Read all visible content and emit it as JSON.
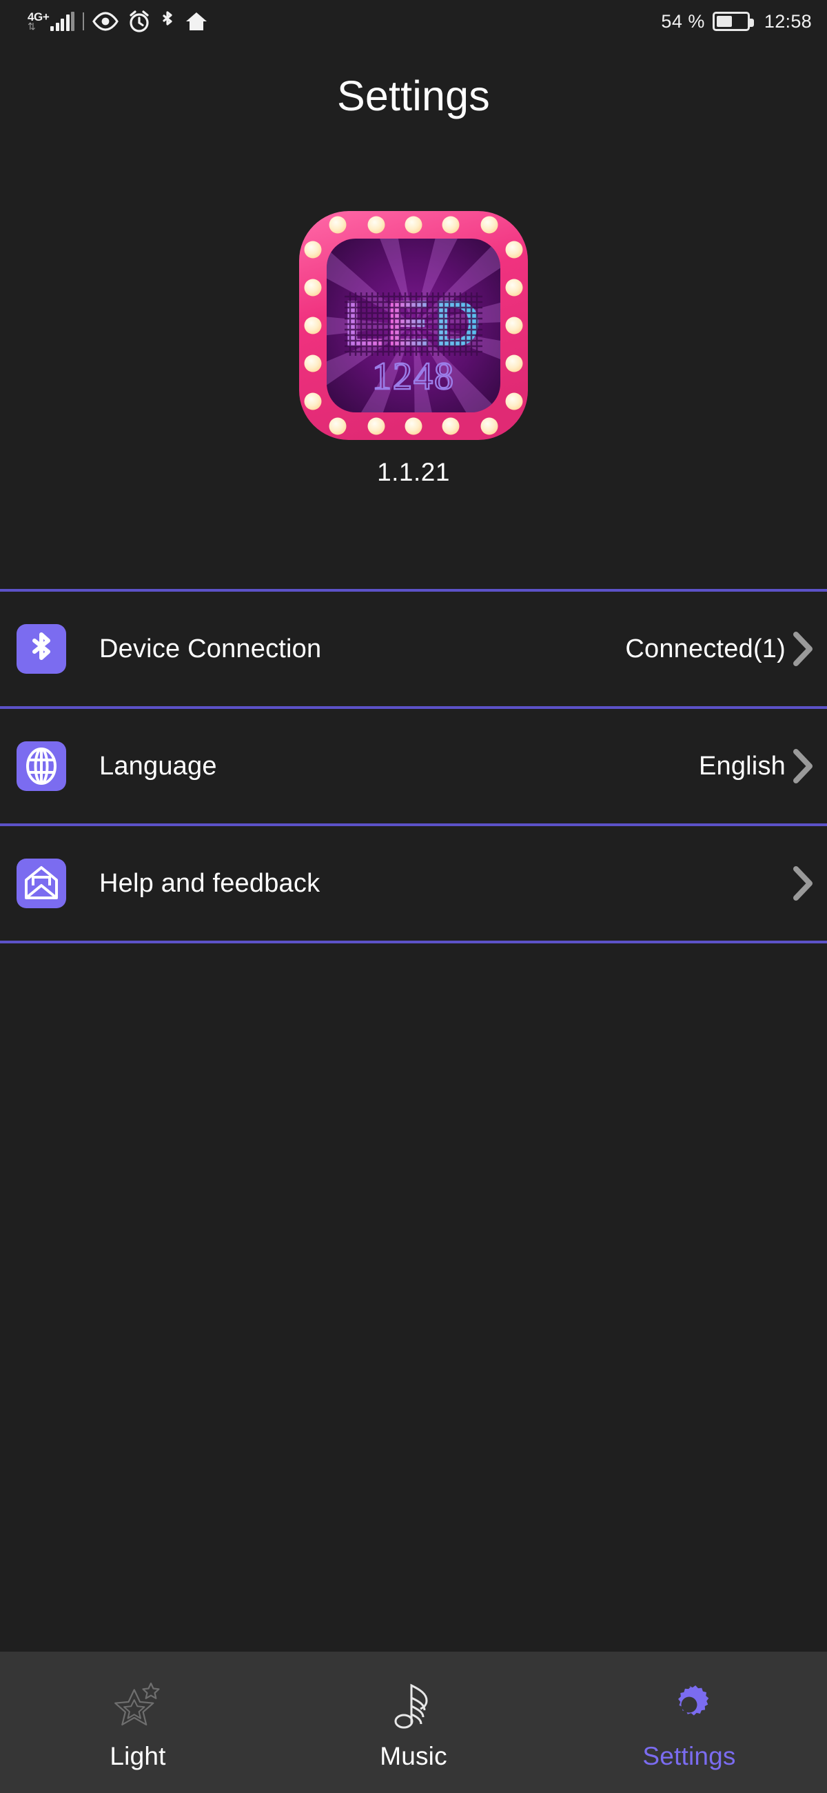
{
  "statusbar": {
    "network_generation": "4G+",
    "data_arrows": "⇅",
    "signal_icon": "signal-bars-icon",
    "eye_icon": "eye-icon",
    "alarm_icon": "alarm-clock-icon",
    "bluetooth_icon": "bluetooth-icon",
    "home_icon": "home-icon",
    "battery_percent": "54 %",
    "battery_icon": "battery-icon",
    "time": "12:58"
  },
  "header": {
    "title": "Settings"
  },
  "app_logo": {
    "icon_name": "led-1248-app-logo",
    "marquee_text": "LED",
    "sub_text": "1248",
    "version": "1.1.21",
    "frame_color": "#f0478f",
    "bulb_color": "#fff3dd",
    "screen_color": "#5d0f6b",
    "led_pink": "#f06fe0",
    "led_blue": "#56c8f5",
    "sub_text_color": "#9b7de8"
  },
  "settings_list": {
    "divider_color": "#5c52c8",
    "tile_color": "#7b6cf0",
    "chevron_color": "#9a9a9a",
    "rows": [
      {
        "icon": "bluetooth-icon",
        "label": "Device Connection",
        "value": "Connected(1)",
        "chevron": "chevron-right-icon"
      },
      {
        "icon": "globe-icon",
        "label": "Language",
        "value": "English",
        "chevron": "chevron-right-icon"
      },
      {
        "icon": "envelope-icon",
        "label": "Help and feedback",
        "value": "",
        "chevron": "chevron-right-icon"
      }
    ]
  },
  "bottom_nav": {
    "active_color": "#7b6cf0",
    "inactive_color": "#ffffff",
    "background": "#363636",
    "items": [
      {
        "icon": "star-outline-icon",
        "label": "Light",
        "active": false
      },
      {
        "icon": "music-note-icon",
        "label": "Music",
        "active": false
      },
      {
        "icon": "gear-icon",
        "label": "Settings",
        "active": true
      }
    ]
  }
}
